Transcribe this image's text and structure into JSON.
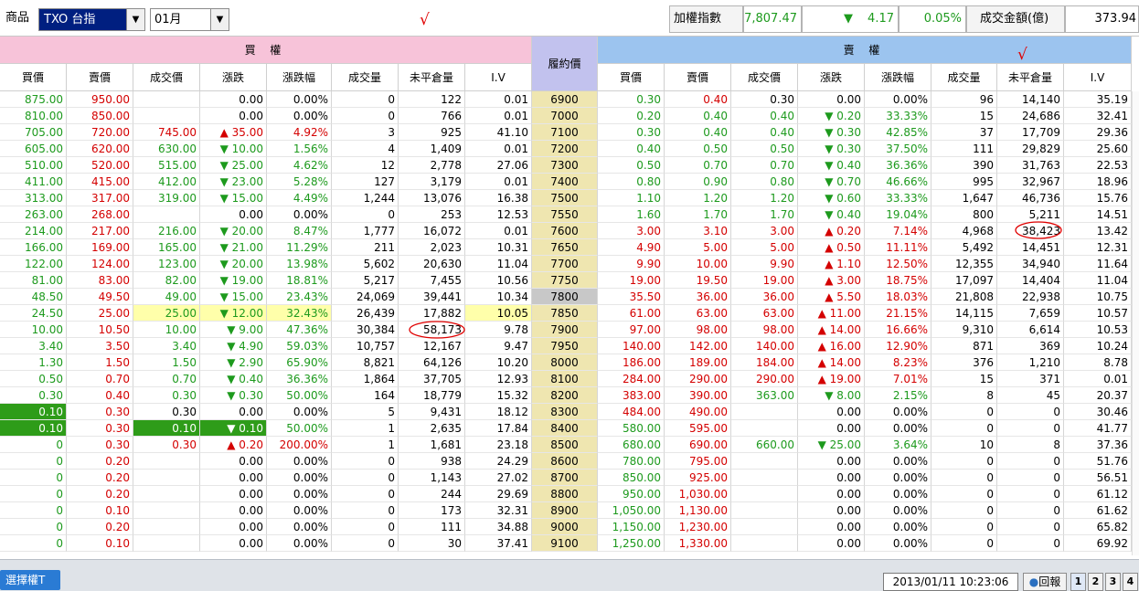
{
  "colors": {
    "up": "#d40000",
    "down": "#1d9a1d",
    "flat": "#000000",
    "call_header_bg": "#f7c3d9",
    "put_header_bg": "#9cc4ef",
    "strike_header_bg": "#c2c2ee",
    "strike_col_bg": "#efe6b0",
    "atm_strike_bg": "#c8c8c8",
    "highlight_yellow": "#ffffaa",
    "highlight_green": "#2e9c19",
    "annotation_red": "#e00000"
  },
  "top": {
    "product_label": "商品",
    "product_value": "TXO 台指",
    "month_value": "01月",
    "dropdown_icon": "▼",
    "index_label": "加權指數",
    "index_value": "7,807.47",
    "index_arrow": "▼",
    "index_change": "4.17",
    "index_pct": "0.05%",
    "turnover_label": "成交金額(億)",
    "turnover_value": "373.94",
    "checkmark": "√"
  },
  "headers": {
    "call_group": "買 權",
    "put_group": "賣 權",
    "strike": "履約價",
    "call_cols": [
      "買價",
      "賣價",
      "成交價",
      "漲跌",
      "漲跌幅",
      "成交量",
      "未平倉量",
      "I.V"
    ],
    "put_cols": [
      "買價",
      "賣價",
      "成交價",
      "漲跌",
      "漲跌幅",
      "成交量",
      "未平倉量",
      "I.V"
    ]
  },
  "rows": [
    {
      "strike": "6900",
      "c": [
        "875.00",
        "950.00",
        "",
        "0.00",
        "0.00%",
        "0",
        "122",
        "0.01"
      ],
      "ct": "f",
      "p": [
        "0.30",
        "0.40",
        "0.30",
        "0.00",
        "0.00%",
        "96",
        "14,140",
        "35.19"
      ],
      "pt": "f",
      "pbid": "d",
      "pask": "u"
    },
    {
      "strike": "7000",
      "c": [
        "810.00",
        "850.00",
        "",
        "0.00",
        "0.00%",
        "0",
        "766",
        "0.01"
      ],
      "ct": "f",
      "p": [
        "0.20",
        "0.40",
        "0.40",
        "▼ 0.20",
        "33.33%",
        "15",
        "24,686",
        "32.41"
      ],
      "pt": "d"
    },
    {
      "strike": "7100",
      "c": [
        "705.00",
        "720.00",
        "745.00",
        "▲ 35.00",
        "4.92%",
        "3",
        "925",
        "41.10"
      ],
      "ct": "u",
      "p": [
        "0.30",
        "0.40",
        "0.40",
        "▼ 0.30",
        "42.85%",
        "37",
        "17,709",
        "29.36"
      ],
      "pt": "d"
    },
    {
      "strike": "7200",
      "c": [
        "605.00",
        "620.00",
        "630.00",
        "▼ 10.00",
        "1.56%",
        "4",
        "1,409",
        "0.01"
      ],
      "ct": "d",
      "p": [
        "0.40",
        "0.50",
        "0.50",
        "▼ 0.30",
        "37.50%",
        "111",
        "29,829",
        "25.60"
      ],
      "pt": "d"
    },
    {
      "strike": "7300",
      "c": [
        "510.00",
        "520.00",
        "515.00",
        "▼ 25.00",
        "4.62%",
        "12",
        "2,778",
        "27.06"
      ],
      "ct": "d",
      "p": [
        "0.50",
        "0.70",
        "0.70",
        "▼ 0.40",
        "36.36%",
        "390",
        "31,763",
        "22.53"
      ],
      "pt": "d"
    },
    {
      "strike": "7400",
      "c": [
        "411.00",
        "415.00",
        "412.00",
        "▼ 23.00",
        "5.28%",
        "127",
        "3,179",
        "0.01"
      ],
      "ct": "d",
      "p": [
        "0.80",
        "0.90",
        "0.80",
        "▼ 0.70",
        "46.66%",
        "995",
        "32,967",
        "18.96"
      ],
      "pt": "d"
    },
    {
      "strike": "7500",
      "c": [
        "313.00",
        "317.00",
        "319.00",
        "▼ 15.00",
        "4.49%",
        "1,244",
        "13,076",
        "16.38"
      ],
      "ct": "d",
      "p": [
        "1.10",
        "1.20",
        "1.20",
        "▼ 0.60",
        "33.33%",
        "1,647",
        "46,736",
        "15.76"
      ],
      "pt": "d"
    },
    {
      "strike": "7550",
      "c": [
        "263.00",
        "268.00",
        "",
        "0.00",
        "0.00%",
        "0",
        "253",
        "12.53"
      ],
      "ct": "f",
      "p": [
        "1.60",
        "1.70",
        "1.70",
        "▼ 0.40",
        "19.04%",
        "800",
        "5,211",
        "14.51"
      ],
      "pt": "d"
    },
    {
      "strike": "7600",
      "c": [
        "214.00",
        "217.00",
        "216.00",
        "▼ 20.00",
        "8.47%",
        "1,777",
        "16,072",
        "0.01"
      ],
      "ct": "d",
      "p": [
        "3.00",
        "3.10",
        "3.00",
        "▲ 0.20",
        "7.14%",
        "4,968",
        "38,423",
        "13.42"
      ],
      "pt": "u"
    },
    {
      "strike": "7650",
      "c": [
        "166.00",
        "169.00",
        "165.00",
        "▼ 21.00",
        "11.29%",
        "211",
        "2,023",
        "10.31"
      ],
      "ct": "d",
      "p": [
        "4.90",
        "5.00",
        "5.00",
        "▲ 0.50",
        "11.11%",
        "5,492",
        "14,451",
        "12.31"
      ],
      "pt": "u"
    },
    {
      "strike": "7700",
      "c": [
        "122.00",
        "124.00",
        "123.00",
        "▼ 20.00",
        "13.98%",
        "5,602",
        "20,630",
        "11.04"
      ],
      "ct": "d",
      "p": [
        "9.90",
        "10.00",
        "9.90",
        "▲ 1.10",
        "12.50%",
        "12,355",
        "34,940",
        "11.64"
      ],
      "pt": "u"
    },
    {
      "strike": "7750",
      "c": [
        "81.00",
        "83.00",
        "82.00",
        "▼ 19.00",
        "18.81%",
        "5,217",
        "7,455",
        "10.56"
      ],
      "ct": "d",
      "p": [
        "19.00",
        "19.50",
        "19.00",
        "▲ 3.00",
        "18.75%",
        "17,097",
        "14,404",
        "11.04"
      ],
      "pt": "u"
    },
    {
      "strike": "7800",
      "c": [
        "48.50",
        "49.50",
        "49.00",
        "▼ 15.00",
        "23.43%",
        "24,069",
        "39,441",
        "10.34"
      ],
      "ct": "d",
      "p": [
        "35.50",
        "36.00",
        "36.00",
        "▲ 5.50",
        "18.03%",
        "21,808",
        "22,938",
        "10.75"
      ],
      "pt": "u",
      "atm": true
    },
    {
      "strike": "7850",
      "c": [
        "24.50",
        "25.00",
        "25.00",
        "▼ 12.00",
        "32.43%",
        "26,439",
        "17,882",
        "10.05"
      ],
      "ct": "d",
      "p": [
        "61.00",
        "63.00",
        "63.00",
        "▲ 11.00",
        "21.15%",
        "14,115",
        "7,659",
        "10.57"
      ],
      "pt": "u",
      "hl": "yellow"
    },
    {
      "strike": "7900",
      "c": [
        "10.00",
        "10.50",
        "10.00",
        "▼ 9.00",
        "47.36%",
        "30,384",
        "58,173",
        "9.78"
      ],
      "ct": "d",
      "p": [
        "97.00",
        "98.00",
        "98.00",
        "▲ 14.00",
        "16.66%",
        "9,310",
        "6,614",
        "10.53"
      ],
      "pt": "u"
    },
    {
      "strike": "7950",
      "c": [
        "3.40",
        "3.50",
        "3.40",
        "▼ 4.90",
        "59.03%",
        "10,757",
        "12,167",
        "9.47"
      ],
      "ct": "d",
      "p": [
        "140.00",
        "142.00",
        "140.00",
        "▲ 16.00",
        "12.90%",
        "871",
        "369",
        "10.24"
      ],
      "pt": "u"
    },
    {
      "strike": "8000",
      "c": [
        "1.30",
        "1.50",
        "1.50",
        "▼ 2.90",
        "65.90%",
        "8,821",
        "64,126",
        "10.20"
      ],
      "ct": "d",
      "p": [
        "186.00",
        "189.00",
        "184.00",
        "▲ 14.00",
        "8.23%",
        "376",
        "1,210",
        "8.78"
      ],
      "pt": "u"
    },
    {
      "strike": "8100",
      "c": [
        "0.50",
        "0.70",
        "0.70",
        "▼ 0.40",
        "36.36%",
        "1,864",
        "37,705",
        "12.93"
      ],
      "ct": "d",
      "p": [
        "284.00",
        "290.00",
        "290.00",
        "▲ 19.00",
        "7.01%",
        "15",
        "371",
        "0.01"
      ],
      "pt": "u"
    },
    {
      "strike": "8200",
      "c": [
        "0.30",
        "0.40",
        "0.30",
        "▼ 0.30",
        "50.00%",
        "164",
        "18,779",
        "15.32"
      ],
      "ct": "d",
      "p": [
        "383.00",
        "390.00",
        "363.00",
        "▼ 8.00",
        "2.15%",
        "8",
        "45",
        "20.37"
      ],
      "pt": "d",
      "pbid": "u",
      "pask": "u"
    },
    {
      "strike": "8300",
      "c": [
        "0.10",
        "0.30",
        "0.30",
        "0.00",
        "0.00%",
        "5",
        "9,431",
        "18.12"
      ],
      "ct": "f",
      "p": [
        "484.00",
        "490.00",
        "",
        "0.00",
        "0.00%",
        "0",
        "0",
        "30.46"
      ],
      "pt": "f",
      "pbid": "u",
      "pask": "u",
      "hlc": [
        0
      ]
    },
    {
      "strike": "8400",
      "c": [
        "0.10",
        "0.30",
        "0.10",
        "▼ 0.10",
        "50.00%",
        "1",
        "2,635",
        "17.84"
      ],
      "ct": "d",
      "p": [
        "580.00",
        "595.00",
        "",
        "0.00",
        "0.00%",
        "0",
        "0",
        "41.77"
      ],
      "pt": "f",
      "pbid": "d",
      "pask": "u",
      "hlc": [
        0,
        2,
        3
      ]
    },
    {
      "strike": "8500",
      "c": [
        "0",
        "0.30",
        "0.30",
        "▲ 0.20",
        "200.00%",
        "1",
        "1,681",
        "23.18"
      ],
      "ct": "u",
      "p": [
        "680.00",
        "690.00",
        "660.00",
        "▼ 25.00",
        "3.64%",
        "10",
        "8",
        "37.36"
      ],
      "pt": "d",
      "pbid": "d",
      "pask": "u"
    },
    {
      "strike": "8600",
      "c": [
        "0",
        "0.20",
        "",
        "0.00",
        "0.00%",
        "0",
        "938",
        "24.29"
      ],
      "ct": "f",
      "p": [
        "780.00",
        "795.00",
        "",
        "0.00",
        "0.00%",
        "0",
        "0",
        "51.76"
      ],
      "pt": "f",
      "pbid": "d",
      "pask": "u"
    },
    {
      "strike": "8700",
      "c": [
        "0",
        "0.20",
        "",
        "0.00",
        "0.00%",
        "0",
        "1,143",
        "27.02"
      ],
      "ct": "f",
      "p": [
        "850.00",
        "925.00",
        "",
        "0.00",
        "0.00%",
        "0",
        "0",
        "56.51"
      ],
      "pt": "f",
      "pbid": "d",
      "pask": "u"
    },
    {
      "strike": "8800",
      "c": [
        "0",
        "0.20",
        "",
        "0.00",
        "0.00%",
        "0",
        "244",
        "29.69"
      ],
      "ct": "f",
      "p": [
        "950.00",
        "1,030.00",
        "",
        "0.00",
        "0.00%",
        "0",
        "0",
        "61.12"
      ],
      "pt": "f",
      "pbid": "d",
      "pask": "u"
    },
    {
      "strike": "8900",
      "c": [
        "0",
        "0.10",
        "",
        "0.00",
        "0.00%",
        "0",
        "173",
        "32.31"
      ],
      "ct": "f",
      "p": [
        "1,050.00",
        "1,130.00",
        "",
        "0.00",
        "0.00%",
        "0",
        "0",
        "61.62"
      ],
      "pt": "f",
      "pbid": "d",
      "pask": "u"
    },
    {
      "strike": "9000",
      "c": [
        "0",
        "0.20",
        "",
        "0.00",
        "0.00%",
        "0",
        "111",
        "34.88"
      ],
      "ct": "f",
      "p": [
        "1,150.00",
        "1,230.00",
        "",
        "0.00",
        "0.00%",
        "0",
        "0",
        "65.82"
      ],
      "pt": "f",
      "pbid": "d",
      "pask": "u"
    },
    {
      "strike": "9100",
      "c": [
        "0",
        "0.10",
        "",
        "0.00",
        "0.00%",
        "0",
        "30",
        "37.41"
      ],
      "ct": "f",
      "p": [
        "1,250.00",
        "1,330.00",
        "",
        "0.00",
        "0.00%",
        "0",
        "0",
        "69.92"
      ],
      "pt": "f",
      "pbid": "d",
      "pask": "u"
    }
  ],
  "bottom": {
    "tab_label": "選擇權T",
    "datetime": "2013/01/11 10:23:06",
    "back_label": "回報",
    "page_buttons": [
      "1",
      "2",
      "3",
      "4"
    ]
  }
}
